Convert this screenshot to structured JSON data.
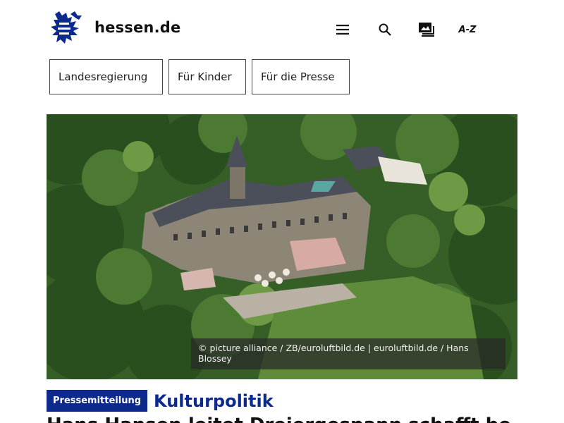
{
  "header": {
    "brand": "hessen.de",
    "menu_icon": "hamburger-menu-icon",
    "search_icon": "search-icon",
    "sign_language_icon": "sign-language-icon",
    "az_label": "A-Z",
    "brand_color": "#0b2a8c"
  },
  "quicklinks": [
    {
      "label": "Landesregierung"
    },
    {
      "label": "Für Kinder"
    },
    {
      "label": "Für die Presse"
    }
  ],
  "hero": {
    "caption": "© picture alliance / ZB/euroluftbild.de | euroluftbild.de / Hans Blossey"
  },
  "article": {
    "badge": "Pressemitteilung",
    "category": "Kulturpolitik",
    "headline": "Hans Hansen leitet Dreiergespann schafft bei Schlösser"
  }
}
